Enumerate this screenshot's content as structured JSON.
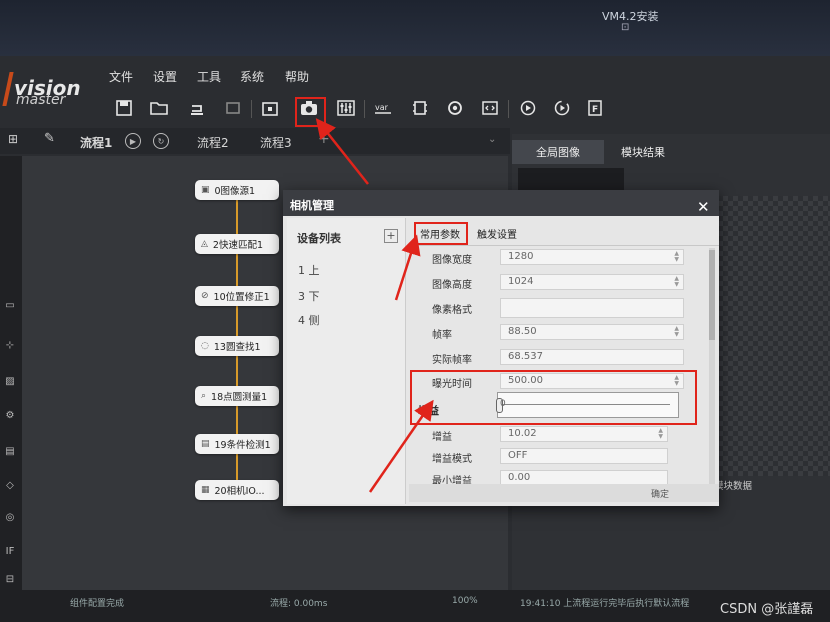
{
  "desktop": {
    "title": "VM4.2安装",
    "icon_glyph": "⊡"
  },
  "app": {
    "logo_main": "vision",
    "logo_sub": "master",
    "menu": [
      "文件",
      "设置",
      "工具",
      "系统",
      "帮助"
    ],
    "toolbar_icons": [
      "save-icon",
      "open-folder-icon",
      "undo-icon",
      "redo-icon",
      "lock-icon",
      "camera-icon",
      "sliders-icon",
      "variable-icon",
      "device-icon",
      "target-icon",
      "code-icon",
      "run-once-icon",
      "run-loop-icon",
      "format-icon"
    ],
    "tabs": [
      {
        "label": "流程1",
        "active": true
      },
      {
        "label": "流程2",
        "active": false
      },
      {
        "label": "流程3",
        "active": false
      }
    ],
    "flow_nodes": [
      {
        "label": "0图像源1",
        "icon": "image-icon"
      },
      {
        "label": "2快速匹配1",
        "icon": "match-icon"
      },
      {
        "label": "10位置修正1",
        "icon": "position-icon"
      },
      {
        "label": "13圆查找1",
        "icon": "circle-find-icon"
      },
      {
        "label": "18点圆测量1",
        "icon": "measure-icon"
      },
      {
        "label": "19条件检测1",
        "icon": "condition-icon"
      },
      {
        "label": "20相机IO...",
        "icon": "camera-io-icon"
      }
    ],
    "right_tabs": [
      "全局图像",
      "模块结果"
    ],
    "module_data": "模块数据",
    "status": {
      "left": "组件配置完成",
      "flow_time": "流程: 0.00ms",
      "zoom": "100%",
      "log": "19:41:10  上流程运行完毕后执行默认流程"
    }
  },
  "dialog": {
    "title": "相机管理",
    "device_list_label": "设备列表",
    "add_glyph": "+",
    "devices": [
      "1 上",
      "3 下",
      "4 侧"
    ],
    "tabs": [
      "常用参数",
      "触发设置"
    ],
    "params": [
      {
        "label": "图像宽度",
        "value": "1280",
        "spin": true
      },
      {
        "label": "图像高度",
        "value": "1024",
        "spin": true
      },
      {
        "label": "像素格式",
        "value": "",
        "spin": false
      },
      {
        "label": "帧率",
        "value": "88.50",
        "spin": true
      },
      {
        "label": "实际帧率",
        "value": "68.537",
        "spin": false
      },
      {
        "label": "曝光时间",
        "value": "500.00",
        "spin": true
      }
    ],
    "gain_header": "增益",
    "slider_value": "0",
    "params2": [
      {
        "label": "增益",
        "value": "10.02",
        "spin": true
      },
      {
        "label": "增益模式",
        "value": "OFF",
        "spin": false
      },
      {
        "label": "最小增益",
        "value": "0.00",
        "spin": false
      }
    ],
    "confirm_label": "确定"
  },
  "watermark": "CSDN @张謹磊",
  "colors": {
    "highlight_red": "#e0241b",
    "connector": "#d79a2a"
  }
}
